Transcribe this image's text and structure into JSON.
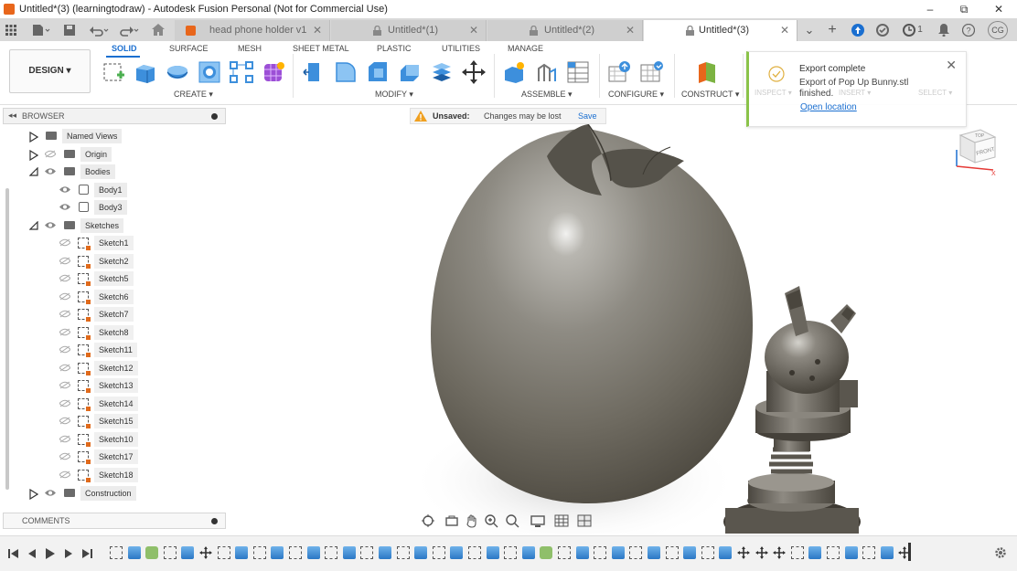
{
  "window": {
    "title": "Untitled*(3) (learningtodraw) - Autodesk Fusion Personal (Not for Commercial Use)",
    "controls": [
      "–",
      "⧉",
      "✕"
    ]
  },
  "tabs": {
    "items": [
      {
        "label": "head phone holder v1",
        "active": false
      },
      {
        "label": "Untitled*(1)",
        "active": false
      },
      {
        "label": "Untitled*(2)",
        "active": false
      },
      {
        "label": "Untitled*(3)",
        "active": true
      }
    ],
    "notification_count": "1",
    "user_initials": "CG"
  },
  "toolbar": {
    "workspace_button": "DESIGN ▾",
    "workspace_tabs": [
      "SOLID",
      "SURFACE",
      "MESH",
      "SHEET METAL",
      "PLASTIC",
      "UTILITIES",
      "MANAGE"
    ],
    "active_tab": "SOLID",
    "groups": [
      {
        "label": "CREATE ▾"
      },
      {
        "label": "MODIFY ▾"
      },
      {
        "label": "ASSEMBLE ▾"
      },
      {
        "label": "CONFIGURE ▾"
      },
      {
        "label": "CONSTRUCT ▾"
      },
      {
        "label": "INSPECT ▾"
      },
      {
        "label": "INSERT ▾"
      },
      {
        "label": "SELECT ▾"
      }
    ]
  },
  "browser": {
    "header": "BROWSER",
    "items": [
      {
        "label": "Named Views",
        "kind": "folder",
        "expandable": true
      },
      {
        "label": "Origin",
        "kind": "folder",
        "expandable": true
      },
      {
        "label": "Bodies",
        "kind": "folder",
        "expanded": true
      },
      {
        "label": "Body1",
        "kind": "body"
      },
      {
        "label": "Body3",
        "kind": "body"
      },
      {
        "label": "Sketches",
        "kind": "folder",
        "expanded": true
      },
      {
        "label": "Sketch1",
        "kind": "sketch"
      },
      {
        "label": "Sketch2",
        "kind": "sketch"
      },
      {
        "label": "Sketch5",
        "kind": "sketch"
      },
      {
        "label": "Sketch6",
        "kind": "sketch"
      },
      {
        "label": "Sketch7",
        "kind": "sketch"
      },
      {
        "label": "Sketch8",
        "kind": "sketch"
      },
      {
        "label": "Sketch11",
        "kind": "sketch"
      },
      {
        "label": "Sketch12",
        "kind": "sketch"
      },
      {
        "label": "Sketch13",
        "kind": "sketch"
      },
      {
        "label": "Sketch14",
        "kind": "sketch"
      },
      {
        "label": "Sketch15",
        "kind": "sketch"
      },
      {
        "label": "Sketch10",
        "kind": "sketch"
      },
      {
        "label": "Sketch17",
        "kind": "sketch"
      },
      {
        "label": "Sketch18",
        "kind": "sketch"
      },
      {
        "label": "Construction",
        "kind": "folder",
        "expandable": true
      }
    ]
  },
  "comments": {
    "label": "COMMENTS"
  },
  "unsaved": {
    "title": "Unsaved:",
    "message": "Changes may be lost",
    "save": "Save"
  },
  "notification": {
    "title": "Export complete",
    "body": "Export of Pop Up Bunny.stl finished.",
    "link": "Open location"
  },
  "viewcube": {
    "top": "TOP",
    "front": "FRONT",
    "axis_x": "X"
  },
  "colors": {
    "accent": "#1b6fd0",
    "notification_success": "#8bc34a",
    "warning": "#f0a020",
    "model_metal": "#6e6a60"
  },
  "timeline": {
    "items": [
      "sketch",
      "extrude",
      "feature",
      "sketch",
      "extrude",
      "move",
      "sketch",
      "extrude",
      "sketch",
      "extrude",
      "sketch",
      "extrude",
      "sketch",
      "extrude",
      "sketch",
      "extrude",
      "sketch",
      "extrude",
      "sketch",
      "extrude",
      "sketch",
      "extrude",
      "sketch",
      "extrude",
      "feature",
      "sketch",
      "extrude",
      "sketch",
      "extrude",
      "sketch",
      "extrude",
      "sketch",
      "extrude",
      "sketch",
      "extrude",
      "move",
      "move",
      "move",
      "sketch",
      "extrude",
      "sketch",
      "extrude",
      "sketch",
      "extrude",
      "move"
    ]
  }
}
